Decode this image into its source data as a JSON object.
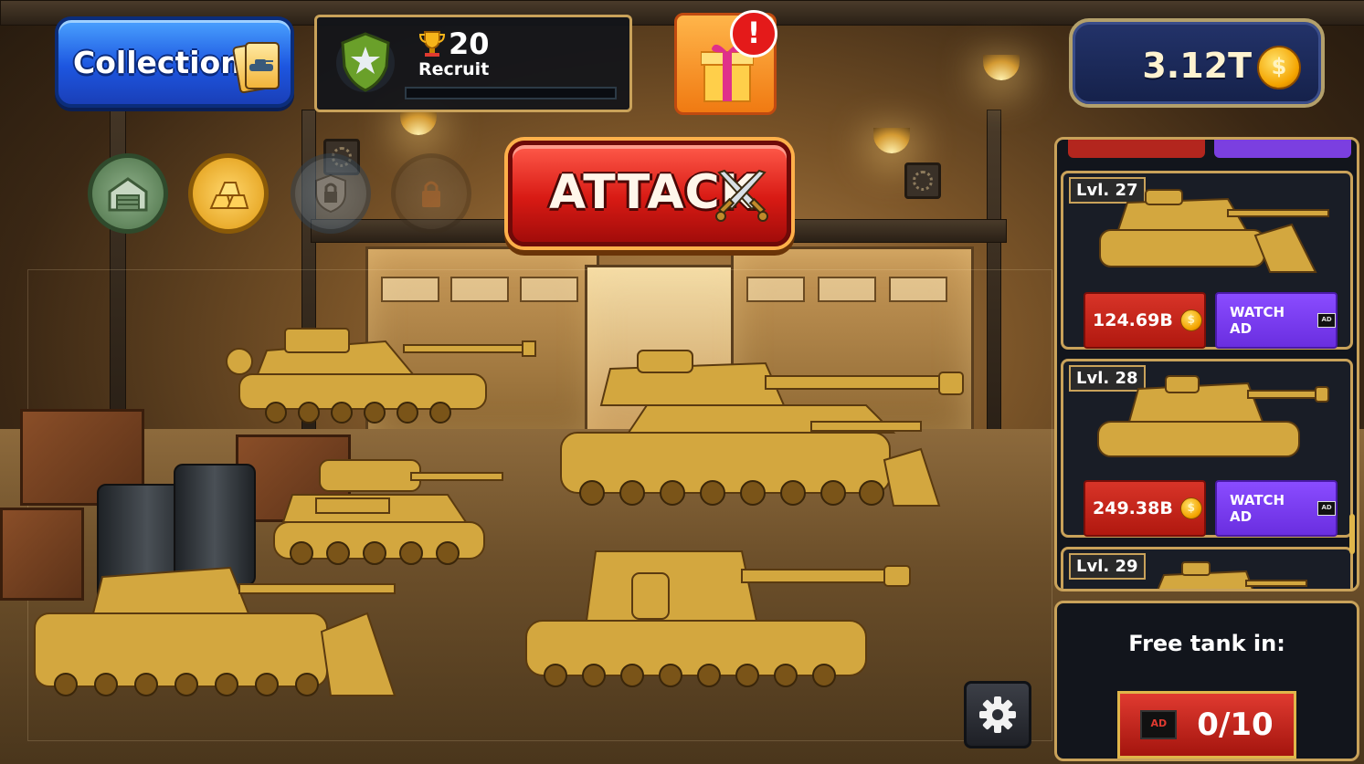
{
  "collection_button": {
    "label": "Collection"
  },
  "rank": {
    "trophies": "20",
    "title": "Recruit"
  },
  "gift": {
    "badge": "!"
  },
  "currency": {
    "amount": "3.12T",
    "coin_symbol": "$"
  },
  "circle_buttons": [
    {
      "icon": "garage-icon"
    },
    {
      "icon": "gold-bars-icon"
    },
    {
      "icon": "locked-shield-icon"
    },
    {
      "icon": "lock-icon"
    }
  ],
  "attack_button": {
    "label": "ATTACK",
    "icon": "crossed-swords-icon"
  },
  "shop": {
    "items": [
      {
        "level": "Lvl. 27",
        "price": "124.69B",
        "ad_label": "WATCH AD"
      },
      {
        "level": "Lvl. 28",
        "price": "249.38B",
        "ad_label": "WATCH AD"
      },
      {
        "level": "Lvl. 29"
      }
    ],
    "tab_colors": [
      "#b3261e",
      "#7b3fe0"
    ]
  },
  "free_tank": {
    "title": "Free tank in:",
    "progress": "0/10",
    "ad_tag": "AD"
  },
  "ad_tag": "AD",
  "colors": {
    "accent_gold": "#c9a25a",
    "buy_red": "#c8231a",
    "ad_purple": "#7b3fe0",
    "collection_blue": "#1d56e0"
  }
}
